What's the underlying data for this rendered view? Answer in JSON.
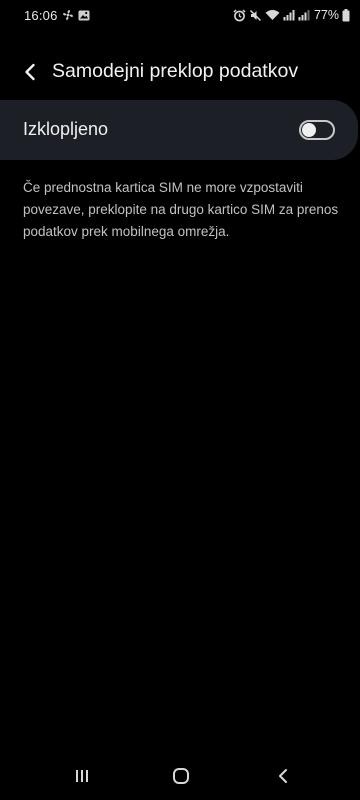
{
  "status_bar": {
    "time": "16:06",
    "battery": "77%",
    "icons_left": [
      "fan-icon",
      "image-icon"
    ],
    "icons_right": [
      "alarm-icon",
      "mute-icon",
      "wifi-icon",
      "signal-icon",
      "signal-icon",
      "battery-icon"
    ]
  },
  "header": {
    "title": "Samodejni preklop podatkov",
    "back_icon": "chevron-left-icon"
  },
  "toggle": {
    "label": "Izklopljeno",
    "state": "off"
  },
  "description": "Če prednostna kartica SIM ne more vzpostaviti povezave, preklopite na drugo kartico SIM za prenos podatkov prek mobilnega omrežja.",
  "nav_bar": {
    "recent_icon": "recent-apps-icon",
    "home_icon": "home-icon",
    "back_icon": "back-icon"
  },
  "colors": {
    "background": "#000000",
    "card": "#1c2026",
    "text": "#f0f0f0",
    "secondary_text": "#c2c2c2"
  }
}
